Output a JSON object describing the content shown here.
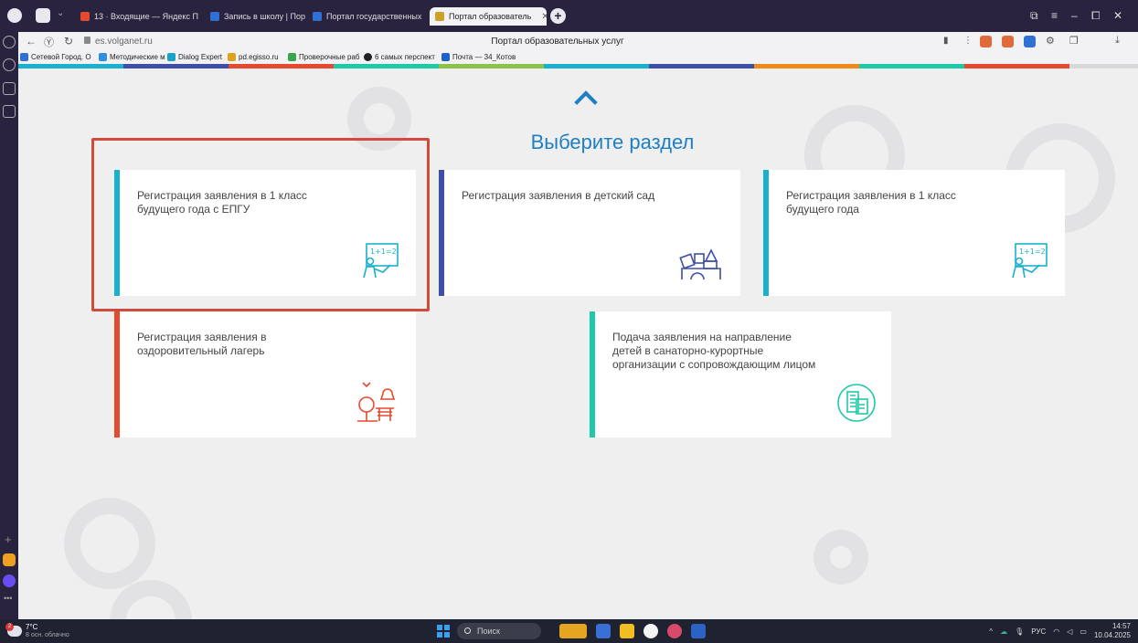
{
  "browser": {
    "tabs": [
      {
        "label": "13 · Входящие — Яндекс П",
        "color": "#e5492f"
      },
      {
        "label": "Запись в школу | Портал с",
        "color": "#2f6fd6"
      },
      {
        "label": "Портал государственных",
        "color": "#2f6fd6"
      },
      {
        "label": "Портал образователь",
        "color": "#c9a227",
        "active": true
      }
    ],
    "address": {
      "url": "es.volganet.ru",
      "page_title": "Портал образовательных услуг"
    },
    "bookmarks": [
      {
        "label": "Сетевой Город. О",
        "color": "#2f6fd6"
      },
      {
        "label": "Методические м",
        "color": "#2f8fe0"
      },
      {
        "label": "Dialog Expert",
        "color": "#1aa3c9"
      },
      {
        "label": "pd.egisso.ru",
        "color": "#e0a21a"
      },
      {
        "label": "Проверочные раб",
        "color": "#3aa64a"
      },
      {
        "label": "6 самых перспект",
        "color": "#222222"
      },
      {
        "label": "Почта — 34_Котов",
        "color": "#1a62c9"
      }
    ]
  },
  "page": {
    "heading": "Выберите раздел",
    "cards": [
      {
        "label": "Регистрация заявления в 1 класс будущего года с ЕПГУ",
        "accent": "#1ab0cf",
        "icon": "teacher-board-icon"
      },
      {
        "label": "Регистрация заявления в детский сад",
        "accent": "#3d4fa8",
        "icon": "toy-blocks-icon"
      },
      {
        "label": "Регистрация заявления в 1 класс будущего года",
        "accent": "#1ab0cf",
        "icon": "teacher-board-icon"
      },
      {
        "label": "Регистрация заявления в оздоровительный лагерь",
        "accent": "#e5492f",
        "icon": "camp-icon"
      },
      {
        "label": "Подача заявления на направление детей в санаторно-курортные организации с сопровождающим лицом",
        "accent": "#1ec9a8",
        "icon": "document-building-icon"
      }
    ]
  },
  "taskbar": {
    "weather_temp": "7°C",
    "weather_desc": "8 осн. облачно",
    "weather_badge": "2",
    "search_placeholder": "Поиск",
    "lang": "РУС",
    "time": "14:57",
    "date": "10.04.2025"
  }
}
